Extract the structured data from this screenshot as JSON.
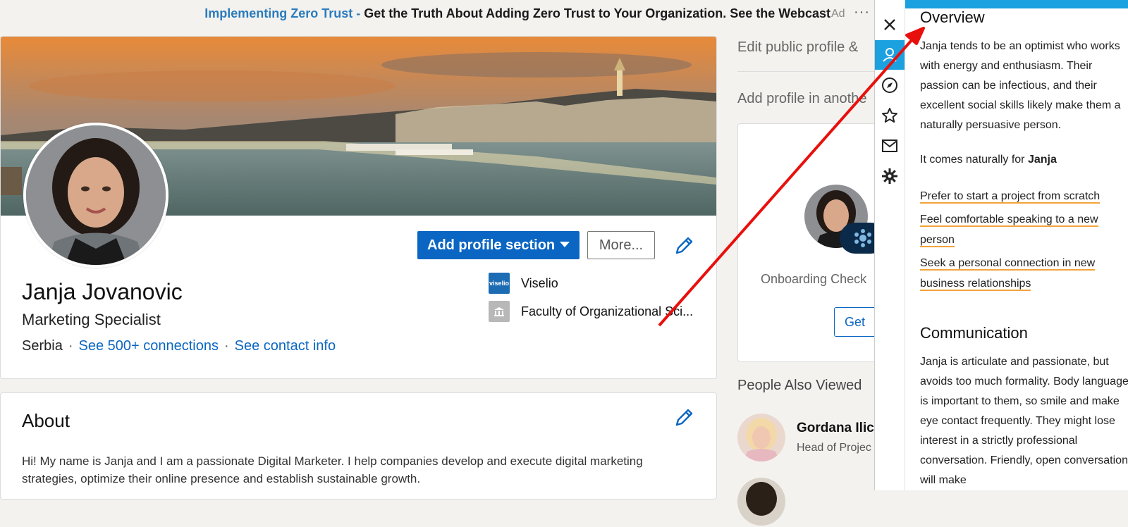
{
  "ad": {
    "headline": "Implementing Zero Trust - ",
    "body": "Get the Truth About Adding Zero Trust to Your Organization. See the Webcast",
    "label": "Ad",
    "more": "···"
  },
  "profile": {
    "name": "Janja Jovanovic",
    "headline": "Marketing Specialist",
    "location": "Serbia",
    "separator": "·",
    "connections_link": "See 500+ connections",
    "contact_link": "See contact info",
    "add_section_button": "Add profile section",
    "more_button": "More...",
    "positions": [
      {
        "name": "Viselio",
        "logo_text": "viselio",
        "color": "#1c6cb3"
      },
      {
        "name": "Faculty of Organizational Sci...",
        "logo_text": "",
        "color": "#b8b8b8"
      }
    ]
  },
  "about": {
    "title": "About",
    "text": "Hi! My name is Janja and I am a passionate Digital Marketer. I help companies develop and execute digital marketing strategies, optimize their online presence and establish sustainable growth."
  },
  "sidebar": {
    "edit_public": "Edit public profile &",
    "add_language": "Add profile in anothe",
    "onboarding_text": "Onboarding Check",
    "get_button": "Get",
    "people_title": "People Also Viewed",
    "people": [
      {
        "name": "Gordana Ilic",
        "title": "Head of Projec"
      },
      {
        "name": "",
        "title": ""
      }
    ]
  },
  "extension": {
    "overview_title": "Overview",
    "overview_text": "Janja tends to be an optimist who works with energy and enthusiasm. Their passion can be infectious, and their excellent social skills likely make them a naturally persuasive person.",
    "natural_prefix": "It comes naturally for ",
    "natural_name": "Janja",
    "highlights": [
      "Prefer to start a project from scratch",
      "Feel comfortable speaking to a new person",
      "Seek a personal connection in new business relationships"
    ],
    "communication_title": "Communication",
    "communication_text": "Janja is articulate and passionate, but avoids too much formality. Body language is important to them, so smile and make eye contact frequently. They might lose interest in a strictly professional conversation. Friendly, open conversation will make",
    "rail_icons": [
      "close-icon",
      "profile-icon",
      "compass-icon",
      "star-icon",
      "mail-icon",
      "gear-icon"
    ],
    "accent": "#1ba0e0"
  },
  "colors": {
    "linkedin_blue": "#0a66c2",
    "highlight_underline": "#f2a33a",
    "arrow": "#e8100c"
  }
}
